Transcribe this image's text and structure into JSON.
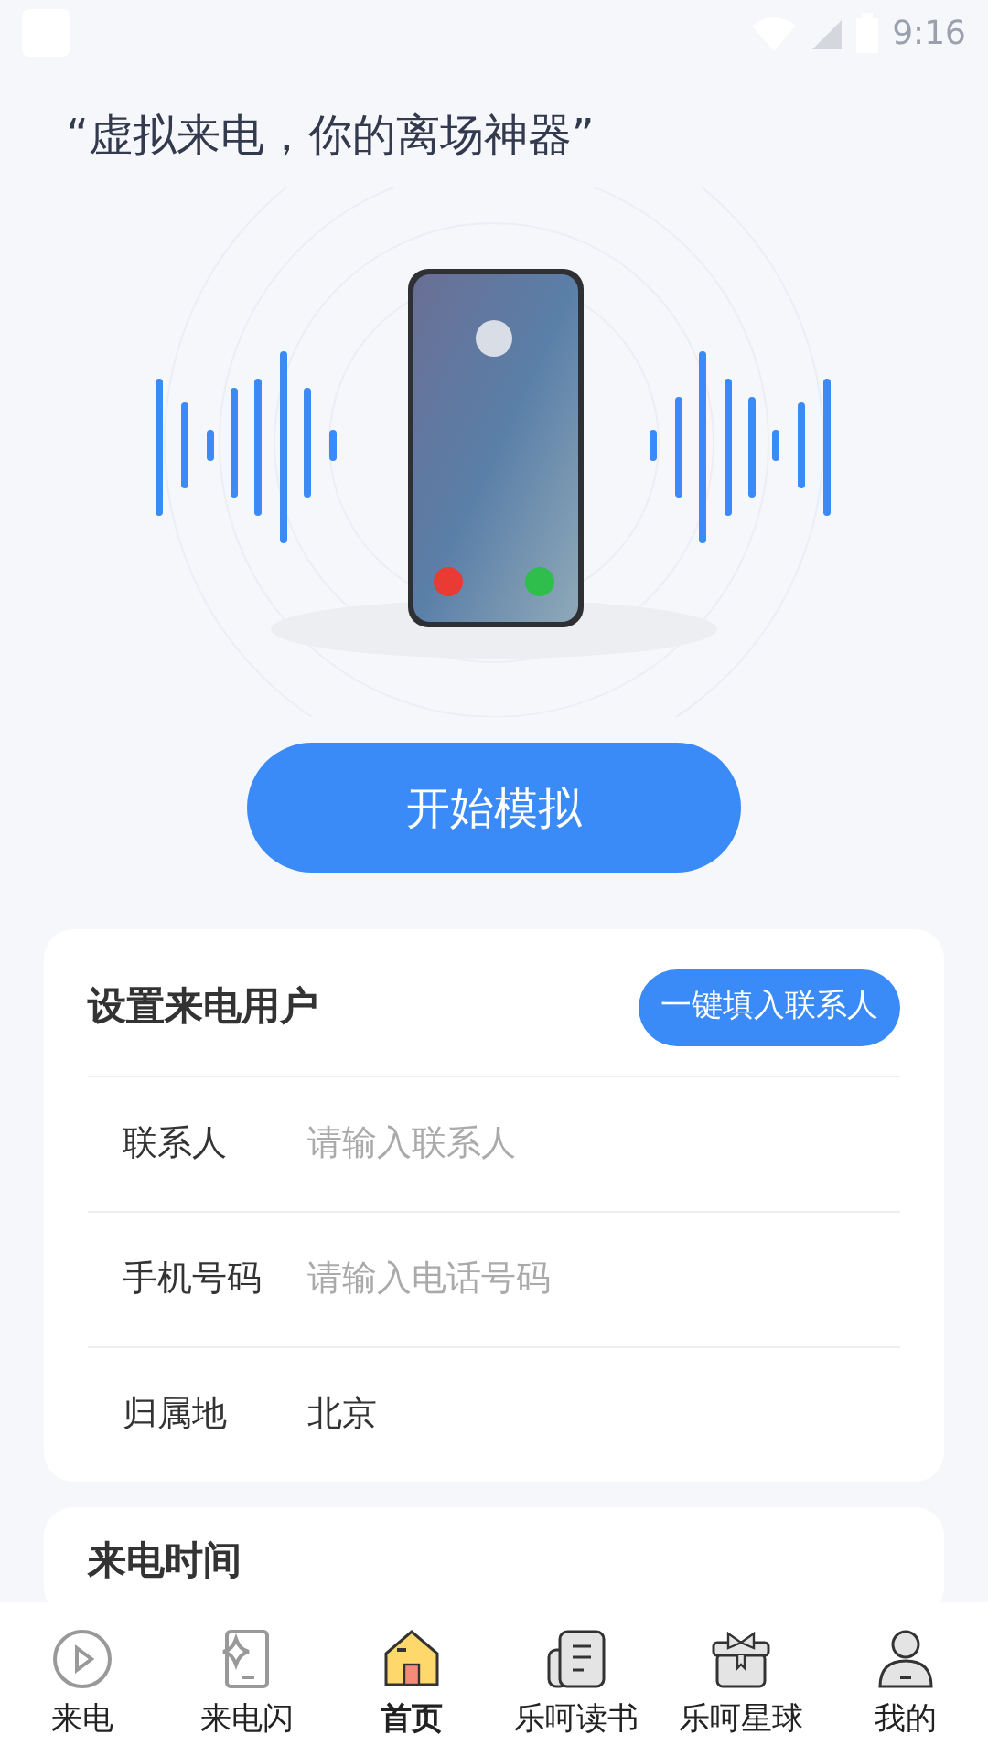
{
  "status_bar": {
    "time": "9:16"
  },
  "slogan": "“虚拟来电，你的离场神器”",
  "start_button": "开始模拟",
  "caller_card": {
    "title": "设置来电用户",
    "fill_button": "一键填入联系人",
    "fields": [
      {
        "label": "联系人",
        "placeholder": "请输入联系人"
      },
      {
        "label": "手机号码",
        "placeholder": "请输入电话号码"
      },
      {
        "label": "归属地",
        "value": "北京"
      }
    ]
  },
  "time_card": {
    "title": "来电时间"
  },
  "bottom_nav": [
    {
      "label": "来电",
      "selected": false
    },
    {
      "label": "来电闪",
      "selected": false
    },
    {
      "label": "首页",
      "selected": true
    },
    {
      "label": "乐呵读书",
      "selected": false
    },
    {
      "label": "乐呵星球",
      "selected": false
    },
    {
      "label": "我的",
      "selected": false
    }
  ]
}
